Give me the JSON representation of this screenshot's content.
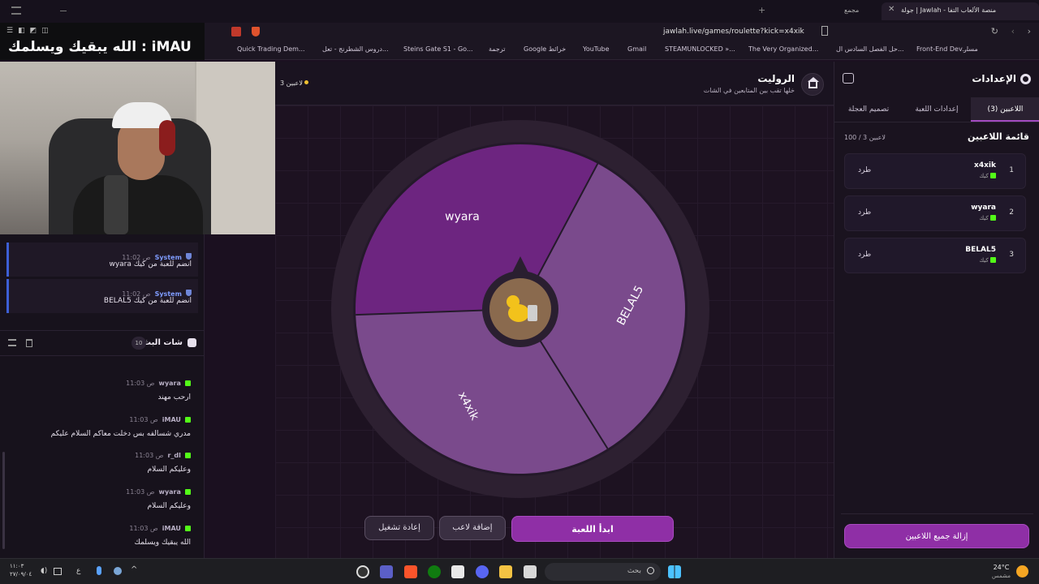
{
  "browser": {
    "tab_title": "جولة | Jawlah - منصة الألعاب التفا",
    "tab_label_2": "مجمع",
    "url": "jawlah.live/games/roulette?kick=x4xik",
    "bookmarks": [
      "Quick Trading Dem...",
      "دروس الشطرنج - تعل...",
      "Steins Gate S1 - Go...",
      "ترجمة",
      "Google خرائط",
      "YouTube",
      "Gmail",
      "STEAMUNLOCKED »...",
      "The Very Organized...",
      "حل الفصل السادس ال...",
      "Front-End Dev...",
      "مسار"
    ]
  },
  "overlay": {
    "caption": "الله يبقيك ويسلمك : iMAU"
  },
  "system_messages": [
    {
      "name": "System",
      "time": "11:02 ص",
      "text": "wyara انضم للعبة من كيك"
    },
    {
      "name": "System",
      "time": "11:02 ص",
      "text": "BELAL5 انضم للعبة من كيك"
    }
  ],
  "chat": {
    "title": "شات البث",
    "count": "10",
    "messages": [
      {
        "name": "wyara",
        "time": "11:03 ص",
        "text": "ارحب مهند"
      },
      {
        "name": "iMAU",
        "time": "11:03 ص",
        "text": "مدري شسالفه بس دخلت معاكم السلام عليكم"
      },
      {
        "name": "r_dl",
        "time": "11:03 ص",
        "text": "وعليكم السلام"
      },
      {
        "name": "wyara",
        "time": "11:03 ص",
        "text": "وعليكم السلام"
      },
      {
        "name": "iMAU",
        "time": "11:03 ص",
        "text": "الله يبقيك ويسلمك"
      }
    ]
  },
  "game": {
    "title": "الروليت",
    "subtitle": "خلها تقب بين المتابعين في الشات",
    "players_count": "3 لاعبين",
    "wheel": [
      {
        "name": "BELAL5",
        "color": "#7a4a8c"
      },
      {
        "name": "x4xik",
        "color": "#7a4a8c"
      },
      {
        "name": "wyara",
        "color": "#6d2580"
      }
    ],
    "buttons": {
      "start": "ابدأ اللعبة",
      "add_player": "إضافة لاعب",
      "restart": "إعادة تشغيل"
    }
  },
  "settings": {
    "title": "الإعدادات",
    "tabs": [
      "اللاعبين (3)",
      "إعدادات اللعبة",
      "تصميم العجلة"
    ],
    "list_title": "قائمة اللاعبين",
    "capacity": "100 / 3 لاعبين",
    "platform": "كيك",
    "kick_label": "طرد",
    "players": [
      {
        "rank": "1",
        "name": "x4xik"
      },
      {
        "rank": "2",
        "name": "wyara"
      },
      {
        "rank": "3",
        "name": "BELAL5"
      }
    ],
    "remove_all": "إزالة جميع اللاعبين"
  },
  "taskbar": {
    "time": "١١:٠٣",
    "date": "٢٧/٠٩/٠٤",
    "search": "بحث",
    "weather_temp": "24°C",
    "weather_text": "مشمس",
    "lang": "ع"
  }
}
